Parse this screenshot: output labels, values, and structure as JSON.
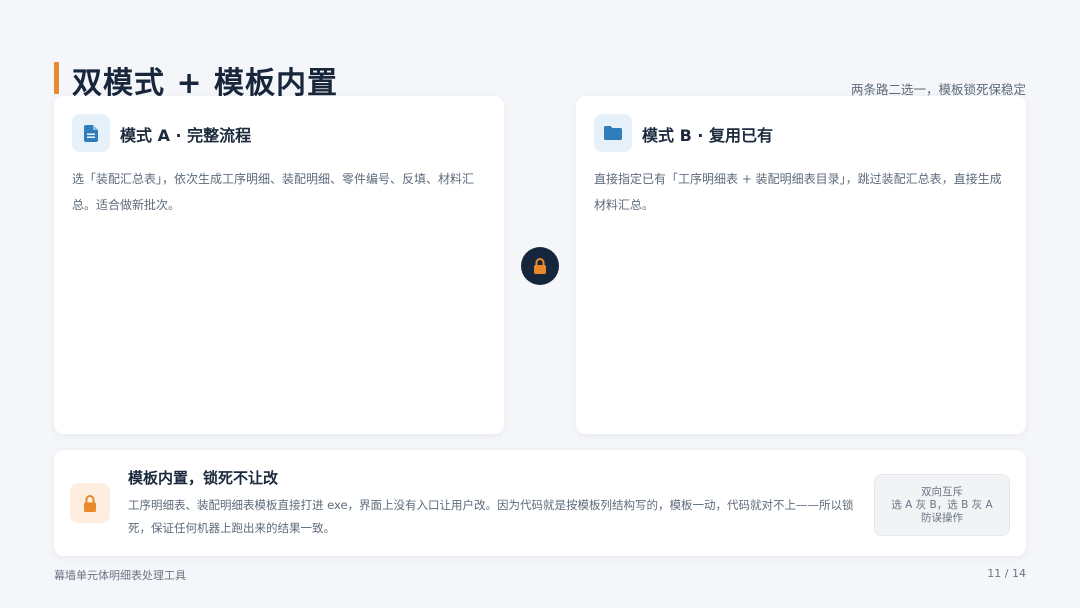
{
  "header": {
    "title": "双模式 + 模板内置",
    "subtitle": "两条路二选一，模板锁死保稳定"
  },
  "mode_a": {
    "icon": "document-icon",
    "title": "模式 A · 完整流程",
    "description": "选「装配汇总表」，依次生成工序明细、装配明细、零件编号、反填、材料汇总。适合做新批次。"
  },
  "mode_b": {
    "icon": "folder-icon",
    "title": "模式 B · 复用已有",
    "description": "直接指定已有「工序明细表 + 装配明细表目录」，跳过装配汇总表，直接生成材料汇总。"
  },
  "center": {
    "icon": "lock-icon"
  },
  "template": {
    "icon": "lock-icon",
    "title": "模板内置，锁死不让改",
    "description": "工序明细表、装配明细表模板直接打进 exe，界面上没有入口让用户改。因为代码就是按模板列结构写的，模板一动，代码就对不上——所以锁死，保证任何机器上跑出来的结果一致。",
    "note": {
      "line1": "双向互斥",
      "line2": "选 A 灰 B，选 B 灰 A",
      "line3": "防误操作"
    }
  },
  "footer": {
    "left": "幕墙单元体明细表处理工具",
    "page": "11 / 14"
  },
  "colors": {
    "accent": "#e8892b",
    "icon_blue": "#2f7dbb",
    "dark": "#16263c",
    "background": "#f4f6f9"
  }
}
